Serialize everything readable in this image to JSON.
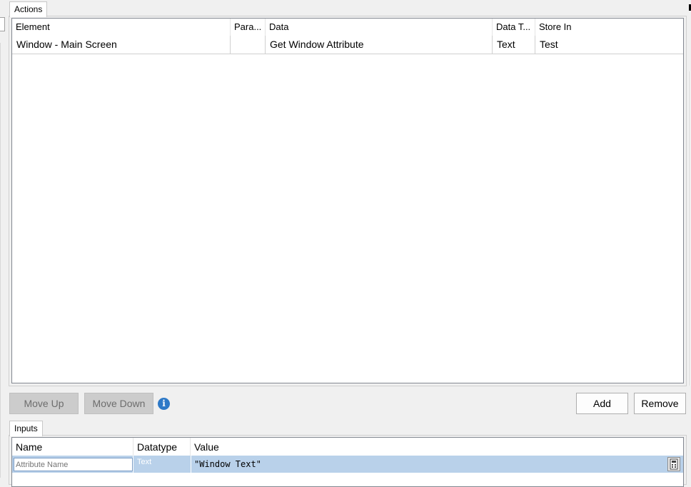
{
  "actions_tab": {
    "label": "Actions"
  },
  "actions_grid": {
    "columns": [
      "Element",
      "Para...",
      "Data",
      "Data T...",
      "Store In"
    ],
    "rows": [
      {
        "element": "Window - Main Screen",
        "params": "",
        "data": "Get Window Attribute",
        "data_type": "Text",
        "store_in": "Test"
      }
    ]
  },
  "buttons": {
    "move_up": "Move Up",
    "move_down": "Move Down",
    "add": "Add",
    "remove": "Remove"
  },
  "inputs_tab": {
    "label": "Inputs"
  },
  "inputs_grid": {
    "columns": [
      "Name",
      "Datatype",
      "Value"
    ],
    "rows": [
      {
        "name_placeholder": "Attribute Name",
        "datatype": "Text",
        "value": "\"Window Text\""
      }
    ]
  },
  "icons": {
    "info": "info-icon",
    "calculator": "calculator-icon"
  },
  "colors": {
    "selection": "#b9d1ea",
    "info_blue": "#2e79c7",
    "disabled_button": "#cccccc"
  }
}
